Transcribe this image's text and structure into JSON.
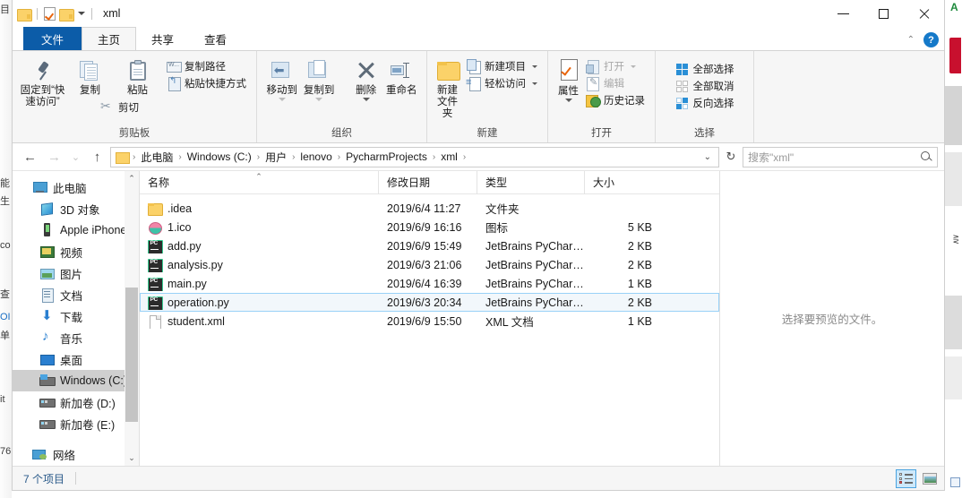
{
  "background": {
    "left_glyphs": [
      "目",
      "能",
      "生",
      "co",
      "查",
      "OI",
      "单",
      "it",
      "76"
    ],
    "right_marker": "A"
  },
  "window": {
    "title": "xml",
    "quick_access": [
      {
        "name": "folder-icon",
        "label": "文件夹"
      },
      {
        "name": "properties-icon",
        "label": "属性"
      },
      {
        "name": "new-folder-icon",
        "label": "新建文件夹"
      },
      {
        "name": "customize-caret",
        "label": "自定义快速访问工具栏"
      }
    ],
    "controls": {
      "minimize": "最小化",
      "maximize": "最大化",
      "close": "关闭"
    }
  },
  "ribbon": {
    "tabs": [
      {
        "label": "文件",
        "kind": "file"
      },
      {
        "label": "主页",
        "kind": "active"
      },
      {
        "label": "共享",
        "kind": "normal"
      },
      {
        "label": "查看",
        "kind": "normal"
      }
    ],
    "collapse_caret": "⌃",
    "help_label": "?",
    "groups": [
      {
        "label": "剪贴板",
        "big": [
          {
            "label": "固定到“快\n速访问”",
            "icon": "pin-icon",
            "line1": "固定到“快",
            "line2": "速访问”"
          },
          {
            "label": "复制",
            "icon": "copy-icon"
          },
          {
            "label": "粘贴",
            "icon": "paste-icon"
          }
        ],
        "small": [
          {
            "label": "复制路径",
            "icon": "copy-path-icon"
          },
          {
            "label": "粘贴快捷方式",
            "icon": "paste-shortcut-icon"
          },
          {
            "label": "剪切",
            "icon": "cut-icon"
          }
        ]
      },
      {
        "label": "组织",
        "big": [
          {
            "label": "移动到",
            "icon": "move-to-icon",
            "caret": true,
            "dim": true
          },
          {
            "label": "复制到",
            "icon": "copy-to-icon",
            "caret": true,
            "dim": true
          },
          {
            "label": "删除",
            "icon": "delete-icon",
            "caret": true
          },
          {
            "label": "重命名",
            "icon": "rename-icon"
          }
        ]
      },
      {
        "label": "新建",
        "big": [
          {
            "label": "新建\n文件夹",
            "icon": "new-folder-icon",
            "line1": "新建",
            "line2": "文件夹"
          }
        ],
        "small": [
          {
            "label": "新建项目",
            "icon": "new-item-icon",
            "caret": true
          },
          {
            "label": "轻松访问",
            "icon": "easy-access-icon",
            "caret": true
          }
        ]
      },
      {
        "label": "打开",
        "big": [
          {
            "label": "属性",
            "icon": "properties-icon",
            "caret": true
          }
        ],
        "small": [
          {
            "label": "打开",
            "icon": "open-icon",
            "caret": true,
            "dim": true
          },
          {
            "label": "编辑",
            "icon": "edit-icon",
            "dim": true
          },
          {
            "label": "历史记录",
            "icon": "history-icon"
          }
        ]
      },
      {
        "label": "选择",
        "small": [
          {
            "label": "全部选择",
            "icon": "select-all-icon"
          },
          {
            "label": "全部取消",
            "icon": "select-none-icon"
          },
          {
            "label": "反向选择",
            "icon": "invert-selection-icon"
          }
        ]
      }
    ]
  },
  "address_bar": {
    "back": "←",
    "forward": "→",
    "recent_caret": "⌄",
    "up": "↑",
    "breadcrumbs": [
      "此电脑",
      "Windows (C:)",
      "用户",
      "lenovo",
      "PycharmProjects",
      "xml"
    ],
    "separator": "›",
    "dropdown_caret": "⌄",
    "refresh": "↻",
    "search_placeholder": "搜索\"xml\""
  },
  "sidebar": {
    "items": [
      {
        "label": "此电脑",
        "icon": "this-pc-icon",
        "indent": false,
        "selected": false
      },
      {
        "label": "3D 对象",
        "icon": "3d-objects-icon",
        "indent": true,
        "selected": false
      },
      {
        "label": "Apple iPhone",
        "icon": "apple-iphone-icon",
        "indent": true,
        "selected": false
      },
      {
        "label": "视频",
        "icon": "videos-icon",
        "indent": true,
        "selected": false
      },
      {
        "label": "图片",
        "icon": "pictures-icon",
        "indent": true,
        "selected": false
      },
      {
        "label": "文档",
        "icon": "documents-icon",
        "indent": true,
        "selected": false
      },
      {
        "label": "下载",
        "icon": "downloads-icon",
        "indent": true,
        "selected": false
      },
      {
        "label": "音乐",
        "icon": "music-icon",
        "indent": true,
        "selected": false
      },
      {
        "label": "桌面",
        "icon": "desktop-icon",
        "indent": true,
        "selected": false
      },
      {
        "label": "Windows (C:)",
        "icon": "drive-windows-icon",
        "indent": true,
        "selected": true
      },
      {
        "label": "新加卷 (D:)",
        "icon": "drive-icon",
        "indent": true,
        "selected": false
      },
      {
        "label": "新加卷 (E:)",
        "icon": "drive-icon",
        "indent": true,
        "selected": false
      },
      {
        "label": "网络",
        "icon": "network-icon",
        "indent": false,
        "selected": false
      }
    ],
    "scroll_up": "⌃",
    "scroll_down": "⌄"
  },
  "file_list": {
    "columns": [
      {
        "label": "名称",
        "key": "name",
        "sorted": true,
        "sort_mark": "⌃"
      },
      {
        "label": "修改日期",
        "key": "date",
        "sorted": false
      },
      {
        "label": "类型",
        "key": "type",
        "sorted": false
      },
      {
        "label": "大小",
        "key": "size",
        "sorted": false
      }
    ],
    "rows": [
      {
        "name": ".idea",
        "date": "2019/6/4 11:27",
        "type": "文件夹",
        "size": "",
        "icon": "folder-icon",
        "selected": false
      },
      {
        "name": "1.ico",
        "date": "2019/6/9 16:16",
        "type": "图标",
        "size": "5 KB",
        "icon": "ico-file-icon",
        "selected": false
      },
      {
        "name": "add.py",
        "date": "2019/6/9 15:49",
        "type": "JetBrains PyChar…",
        "size": "2 KB",
        "icon": "pycharm-icon",
        "selected": false
      },
      {
        "name": "analysis.py",
        "date": "2019/6/3 21:06",
        "type": "JetBrains PyChar…",
        "size": "2 KB",
        "icon": "pycharm-icon",
        "selected": false
      },
      {
        "name": "main.py",
        "date": "2019/6/4 16:39",
        "type": "JetBrains PyChar…",
        "size": "1 KB",
        "icon": "pycharm-icon",
        "selected": false
      },
      {
        "name": "operation.py",
        "date": "2019/6/3 20:34",
        "type": "JetBrains PyChar…",
        "size": "2 KB",
        "icon": "pycharm-icon",
        "selected": true
      },
      {
        "name": "student.xml",
        "date": "2019/6/9 15:50",
        "type": "XML 文档",
        "size": "1 KB",
        "icon": "xml-file-icon",
        "selected": false
      }
    ]
  },
  "preview_pane": {
    "message": "选择要预览的文件。"
  },
  "status_bar": {
    "item_count": "7 个项目",
    "views": [
      {
        "name": "details-view",
        "label": "详细信息",
        "active": true
      },
      {
        "name": "large-icons-view",
        "label": "大图标",
        "active": false
      }
    ]
  },
  "colors": {
    "file_tab_blue": "#0c5ca8",
    "selection_blue": "#99d1f7",
    "sidebar_selected": "#cfcfcf",
    "status_text": "#2a5a8a",
    "folder_yellow": "#fbd269",
    "pycharm_green": "#36c98f"
  }
}
